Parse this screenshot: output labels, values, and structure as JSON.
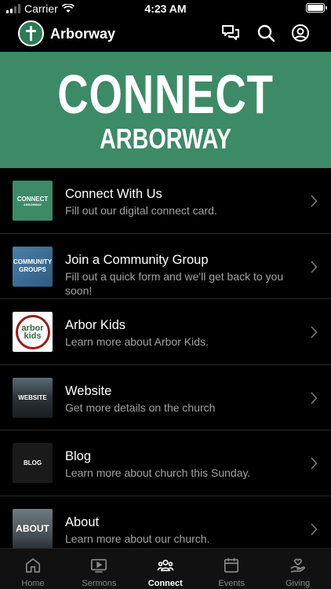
{
  "status_bar": {
    "carrier": "Carrier",
    "time": "4:23 AM",
    "battery_level": 1.0
  },
  "header": {
    "title": "Arborway",
    "icons": [
      "chat-icon",
      "search-icon",
      "profile-icon"
    ]
  },
  "banner": {
    "line1": "CONNECT",
    "line2": "ARBORWAY",
    "background_color": "#3d8a67"
  },
  "items": [
    {
      "title": "Connect With Us",
      "subtitle": "Fill out our digital connect card.",
      "thumb_text": "CONNECT",
      "thumb_small": "ARBORWAY"
    },
    {
      "title": "Join a Community Group",
      "subtitle": "Fill out a quick form and we'll get back to you soon!",
      "thumb_text": "COMMUNITY GROUPS"
    },
    {
      "title": "Arbor Kids",
      "subtitle": "Learn more about Arbor Kids.",
      "thumb_text": "arbor kids"
    },
    {
      "title": "Website",
      "subtitle": "Get more details on the church",
      "thumb_text": "WEBSITE"
    },
    {
      "title": "Blog",
      "subtitle": "Learn more about church this Sunday.",
      "thumb_text": "BLOG"
    },
    {
      "title": "About",
      "subtitle": "Learn more about our church.",
      "thumb_text": "ABOUT"
    }
  ],
  "tabs": [
    {
      "label": "Home",
      "icon": "home-icon"
    },
    {
      "label": "Sermons",
      "icon": "video-icon"
    },
    {
      "label": "Connect",
      "icon": "people-icon",
      "active": true
    },
    {
      "label": "Events",
      "icon": "calendar-icon"
    },
    {
      "label": "Giving",
      "icon": "giving-icon"
    }
  ],
  "colors": {
    "accent": "#3d8a67",
    "background": "#000000",
    "subtitle": "#a3a3a3"
  }
}
